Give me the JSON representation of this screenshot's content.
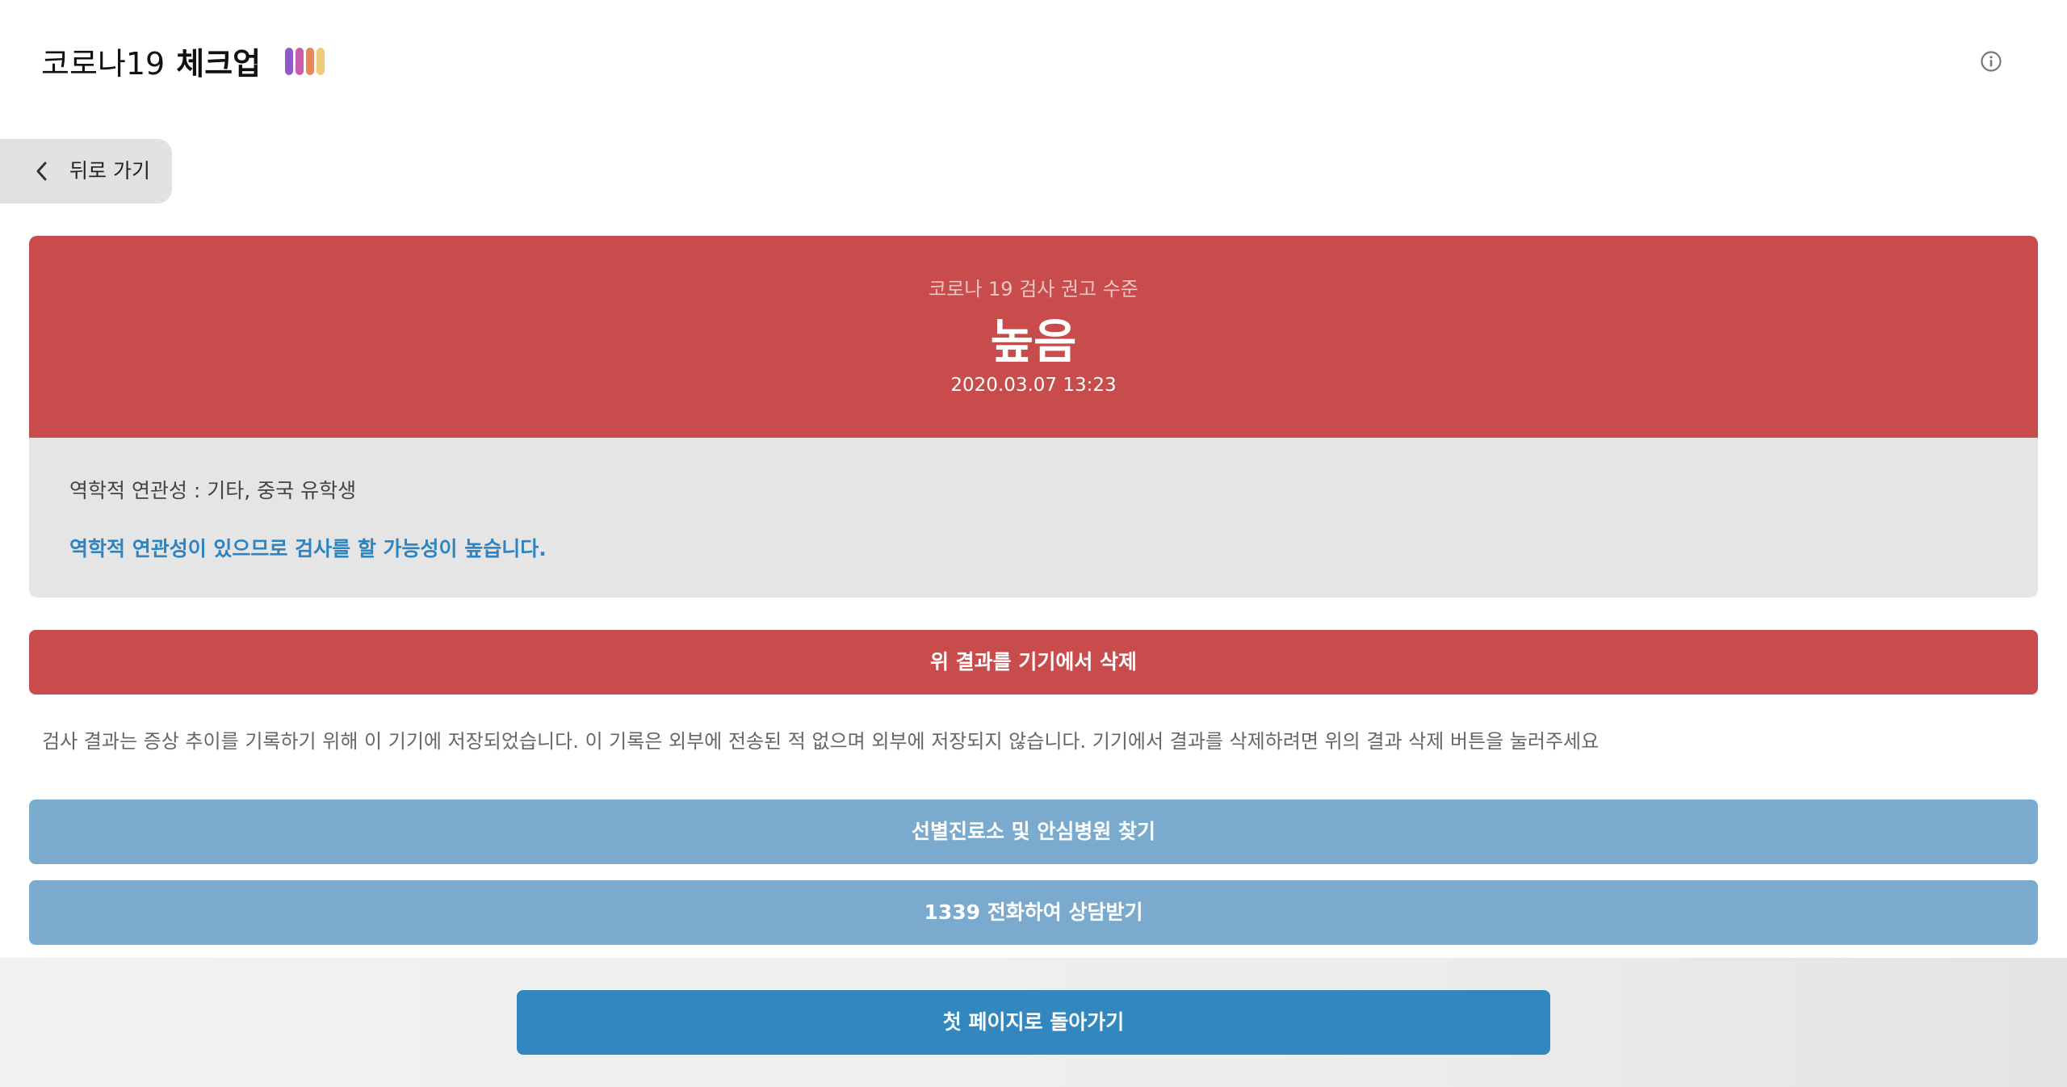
{
  "header": {
    "title_light": "코로나19",
    "title_bold": "체크업",
    "logo_colors": [
      "#8e5cc9",
      "#c85ea9",
      "#e8875a",
      "#f0cb7a"
    ],
    "info_icon": "info-circle-icon"
  },
  "nav": {
    "back_label": "뒤로 가기",
    "back_icon": "chevron-left-icon"
  },
  "result": {
    "subtitle": "코로나 19 검사 권고 수준",
    "level": "높음",
    "date": "2020.03.07 13:23",
    "detail": "역학적 연관성 : 기타, 중국 유학생",
    "note": "역학적 연관성이 있으므로 검사를 할 가능성이 높습니다.",
    "level_color": "#c94c4c",
    "note_color": "#2e84c0"
  },
  "actions": {
    "delete_label": "위 결과를 기기에서 삭제",
    "storage_note": "검사 결과는 증상 추이를 기록하기 위해 이 기기에 저장되었습니다. 이 기록은 외부에 전송된 적 없으며 외부에 저장되지 않습니다. 기기에서 결과를 삭제하려면 위의 결과 삭제 버튼을 눌러주세요",
    "clinic_label": "선별진료소 및 안심병원 찾기",
    "call_label": "1339 전화하여 상담받기",
    "home_label": "첫 페이지로 돌아가기",
    "secondary_color": "#7aabcf",
    "primary_color": "#3387bf"
  }
}
